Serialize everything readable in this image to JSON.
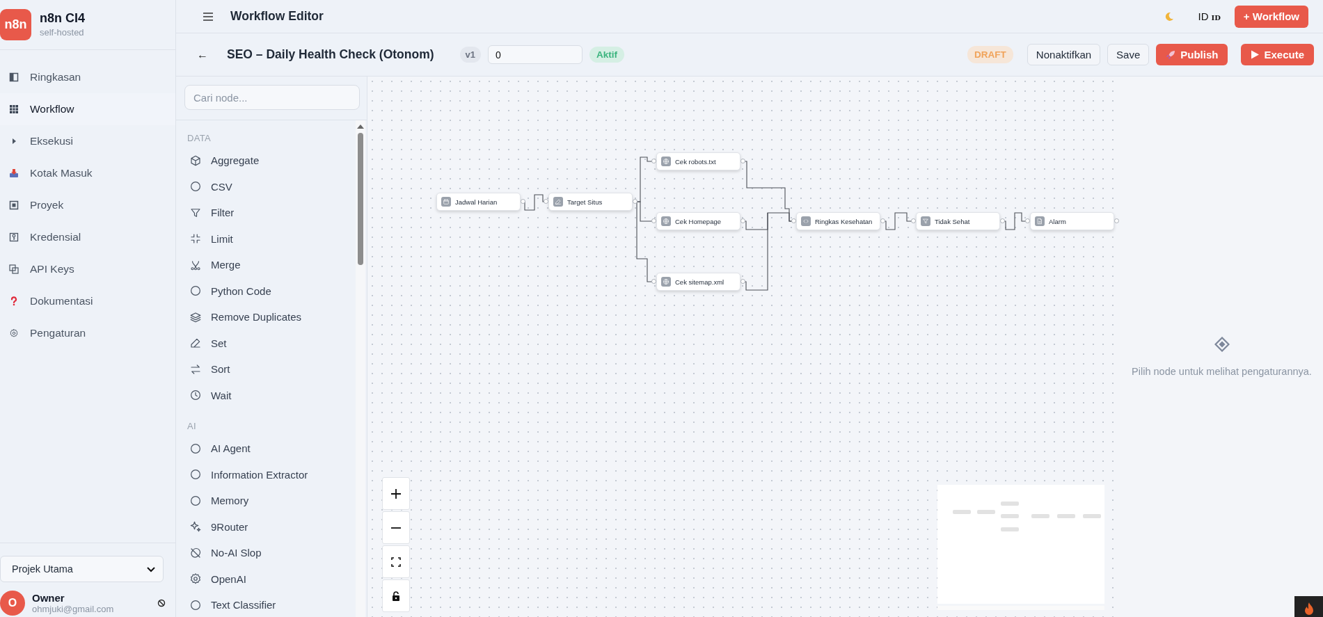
{
  "sidebar": {
    "logo": "n8n",
    "brand": "n8n CI4",
    "subtitle": "self-hosted",
    "items": [
      {
        "label": "Ringkasan",
        "selected": false
      },
      {
        "label": "Workflow",
        "selected": true
      },
      {
        "label": "Eksekusi",
        "selected": false
      },
      {
        "label": "Kotak Masuk",
        "selected": false
      },
      {
        "label": "Proyek",
        "selected": false
      },
      {
        "label": "Kredensial",
        "selected": false
      },
      {
        "label": "API Keys",
        "selected": false
      },
      {
        "label": "Dokumentasi",
        "selected": false
      },
      {
        "label": "Pengaturan",
        "selected": false
      }
    ],
    "project_select": {
      "value": "Projek Utama"
    },
    "user": {
      "avatar": "O",
      "name": "Owner",
      "email": "ohmjuki@gmail.com"
    }
  },
  "topbar": {
    "title": "Workflow Editor",
    "language": "ID",
    "language_code": "ID",
    "new_button": "+ Workflow"
  },
  "editor": {
    "back": "←",
    "workflow_name": "SEO – Daily Health Check (Otonom)",
    "version": "v1",
    "field": {
      "value": "0"
    },
    "status": "Aktif",
    "state_badge": "DRAFT",
    "buttons": [
      {
        "label": "Nonaktifkan",
        "kind": "outline"
      },
      {
        "label": "Save",
        "kind": "outline"
      },
      {
        "label": "Publish",
        "kind": "primary"
      },
      {
        "label": "Execute",
        "kind": "primary"
      }
    ]
  },
  "node_panel": {
    "search": {
      "placeholder": "Cari node..."
    },
    "groups": [
      {
        "title": "DATA",
        "items": [
          "Aggregate",
          "CSV",
          "Filter",
          "Limit",
          "Merge",
          "Python Code",
          "Remove Duplicates",
          "Set",
          "Sort",
          "Wait"
        ]
      },
      {
        "title": "AI",
        "items": [
          "AI Agent",
          "Information Extractor",
          "Memory",
          "9Router",
          "No-AI Slop",
          "OpenAI",
          "Text Classifier"
        ]
      }
    ]
  },
  "canvas": {
    "nodes": [
      {
        "label": "Jadwal Harian"
      },
      {
        "label": "Target Situs"
      },
      {
        "label": "Cek robots.txt"
      },
      {
        "label": "Cek Homepage"
      },
      {
        "label": "Cek sitemap.xml"
      },
      {
        "label": "Ringkas Kesehatan"
      },
      {
        "label": "Tidak Sehat"
      },
      {
        "label": "Alarm"
      }
    ]
  },
  "settings_panel": {
    "empty_message": "Pilih node untuk melihat pengaturannya."
  }
}
